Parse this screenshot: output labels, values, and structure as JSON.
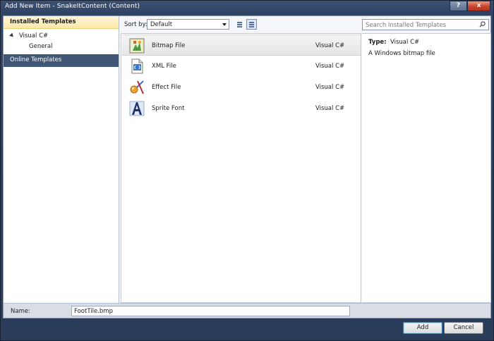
{
  "window": {
    "title": "Add New Item - SnakeItContent (Content)",
    "help_glyph": "?",
    "close_glyph": "x"
  },
  "left": {
    "installed_header": "Installed Templates",
    "tree": [
      {
        "label": "Visual C#"
      },
      {
        "label": "General"
      }
    ],
    "online_header": "Online Templates"
  },
  "toolbar": {
    "sort_label": "Sort by:",
    "sort_value": "Default"
  },
  "search": {
    "placeholder": "Search Installed Templates"
  },
  "templates": [
    {
      "name": "Bitmap File",
      "lang": "Visual C#",
      "icon": "bitmap-icon",
      "selected": true
    },
    {
      "name": "XML File",
      "lang": "Visual C#",
      "icon": "xml-file-icon",
      "selected": false
    },
    {
      "name": "Effect File",
      "lang": "Visual C#",
      "icon": "effect-file-icon",
      "selected": false
    },
    {
      "name": "Sprite Font",
      "lang": "Visual C#",
      "icon": "sprite-font-icon",
      "selected": false
    }
  ],
  "detail": {
    "type_label": "Type:",
    "type_value": "Visual C#",
    "description": "A Windows bitmap file"
  },
  "name_field": {
    "label": "Name:",
    "value": "FootTile.bmp"
  },
  "buttons": {
    "add": "Add",
    "cancel": "Cancel"
  }
}
